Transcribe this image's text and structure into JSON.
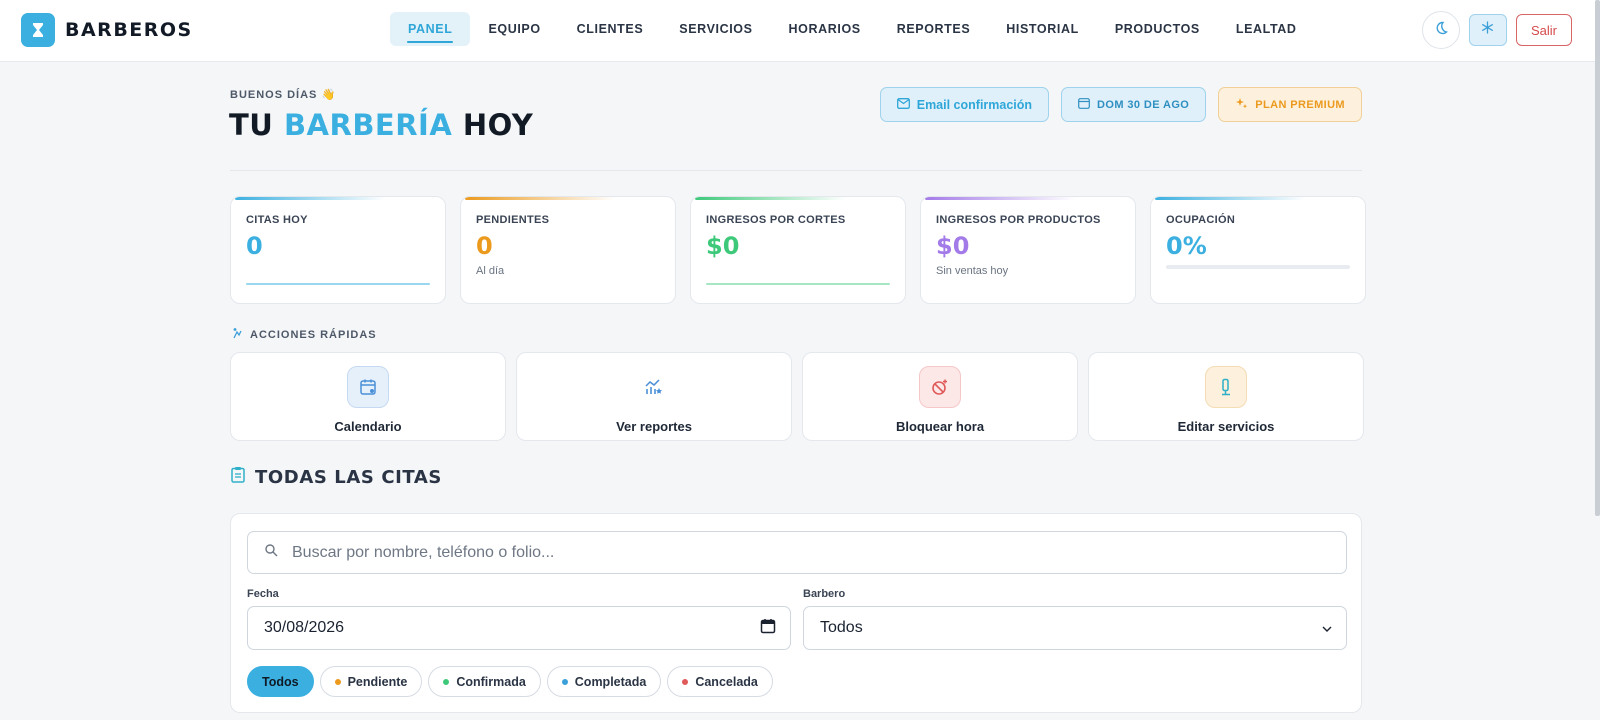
{
  "brand": {
    "name": "BARBEROS"
  },
  "nav": [
    {
      "label": "PANEL",
      "active": true
    },
    {
      "label": "EQUIPO"
    },
    {
      "label": "CLIENTES"
    },
    {
      "label": "SERVICIOS"
    },
    {
      "label": "HORARIOS"
    },
    {
      "label": "REPORTES"
    },
    {
      "label": "HISTORIAL"
    },
    {
      "label": "PRODUCTOS"
    },
    {
      "label": "LEALTAD"
    }
  ],
  "top_actions": {
    "theme_icon": "moon-icon",
    "settings_icon": "snowflake-icon",
    "logout_label": "Salir"
  },
  "header": {
    "greeting": "BUENOS DÍAS 👋",
    "title_prefix": "TU ",
    "title_accent": "BARBERÍA",
    "title_suffix": " HOY",
    "email_button": "Email confirmación",
    "date_badge": "DOM 30 DE AGO",
    "plan_badge": "PLAN PREMIUM"
  },
  "stats": [
    {
      "label": "CITAS HOY",
      "value": "0",
      "sub": "",
      "color": "#3bb0e0"
    },
    {
      "label": "PENDIENTES",
      "value": "0",
      "sub": "Al día",
      "color": "#eb9a1e"
    },
    {
      "label": "INGRESOS POR CORTES",
      "value": "$0",
      "sub": "",
      "color": "#3ec97a"
    },
    {
      "label": "INGRESOS POR PRODUCTOS",
      "value": "$0",
      "sub": "Sin ventas hoy",
      "color": "#a37be8"
    },
    {
      "label": "OCUPACIÓN",
      "value": "0%",
      "sub": "",
      "color": "#3bb0e0",
      "progress": 0
    }
  ],
  "quick_actions": {
    "title": "ACCIONES RÁPIDAS",
    "items": [
      {
        "label": "Calendario",
        "icon": "calendar-icon"
      },
      {
        "label": "Ver reportes",
        "icon": "chart-icon"
      },
      {
        "label": "Bloquear hora",
        "icon": "block-icon"
      },
      {
        "label": "Editar servicios",
        "icon": "razor-icon"
      }
    ]
  },
  "appointments": {
    "title": "TODAS LAS CITAS",
    "search_placeholder": "Buscar por nombre, teléfono o folio...",
    "date_label": "Fecha",
    "date_value": "30/08/2026",
    "barber_label": "Barbero",
    "barber_value": "Todos",
    "filters": [
      {
        "label": "Todos",
        "active": true
      },
      {
        "label": "Pendiente",
        "color": "#eb9a1e"
      },
      {
        "label": "Confirmada",
        "color": "#3ec97a"
      },
      {
        "label": "Completada",
        "color": "#3b9fd8"
      },
      {
        "label": "Cancelada",
        "color": "#e05a5a"
      }
    ]
  }
}
